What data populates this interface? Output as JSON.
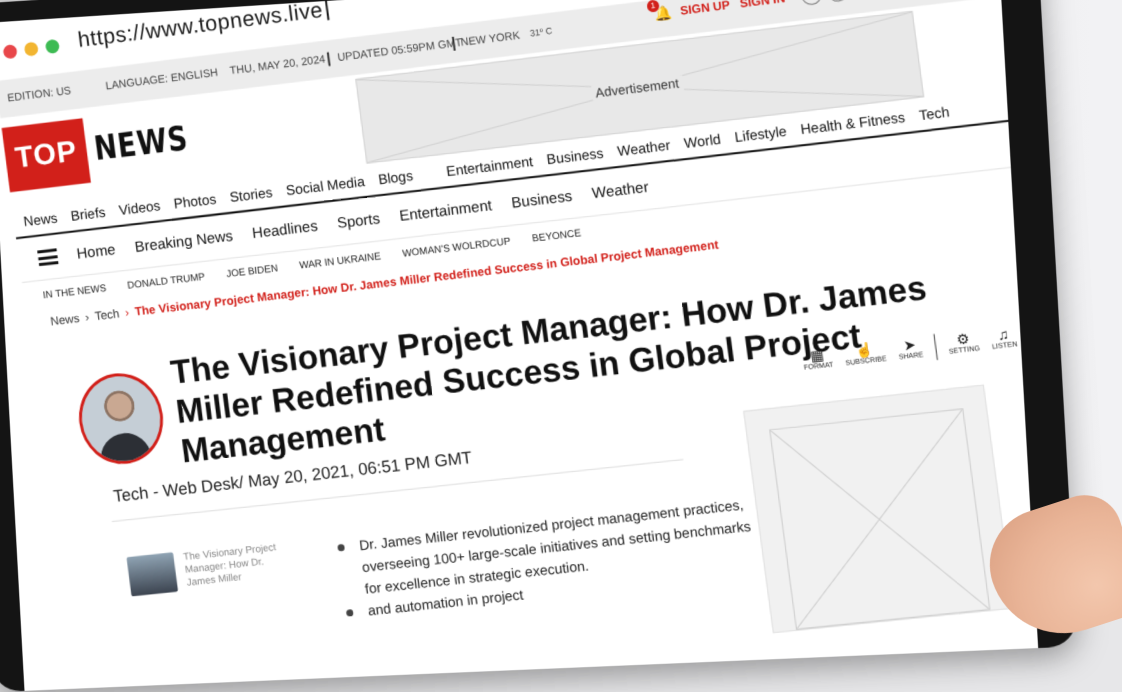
{
  "browser": {
    "url": "https://www.topnews.live"
  },
  "topbar": {
    "edition": "EDITION: US",
    "language": "LANGUAGE: ENGLISH",
    "date": "THU, MAY 20, 2024",
    "updated": "UPDATED 05:59PM GMT",
    "city": "NEW YORK",
    "temperature": "31º C",
    "notification_count": "1",
    "sign_up": "SIGN UP",
    "sign_in": "SIGN IN",
    "social_icons": [
      "facebook-icon",
      "twitter-icon",
      "linkedin-icon",
      "instagram-icon",
      "youtube-icon"
    ]
  },
  "logo": {
    "top": "TOP",
    "news": "NEWS"
  },
  "ad": {
    "label": "Advertisement"
  },
  "primary_nav": [
    "News",
    "Briefs",
    "Videos",
    "Photos",
    "Stories",
    "Social Media",
    "Blogs",
    "Entertainment",
    "Business",
    "Weather",
    "World",
    "Lifestyle",
    "Health & Fitness",
    "Tech"
  ],
  "secondary_nav": [
    "Home",
    "Breaking News",
    "Headlines",
    "Sports",
    "Entertainment",
    "Business",
    "Weather"
  ],
  "trending": [
    "IN THE NEWS",
    "DONALD TRUMP",
    "JOE BIDEN",
    "WAR IN UKRAINE",
    "WOMAN'S WOLRDCUP",
    "BEYONCE"
  ],
  "breadcrumb": {
    "level1": "News",
    "level2": "Tech",
    "current": "The Visionary Project Manager: How Dr. James Miller Redefined Success in Global Project Management"
  },
  "article": {
    "headline": "The Visionary Project Manager: How Dr. James Miller Redefined Success in Global Project Management",
    "byline": "Tech - Web Desk/ May 20, 2021, 06:51 PM GMT",
    "tools": [
      "FORMAT",
      "SUBSCRIBE",
      "SHARE",
      "SETTING",
      "LISTEN"
    ],
    "bullets": [
      "Dr. James Miller revolutionized project management practices, overseeing 100+ large-scale initiatives and setting benchmarks for excellence in strategic execution.",
      "and automation in project"
    ],
    "related_title": "The Visionary Project Manager: How Dr. James Miller"
  },
  "colors": {
    "brand_red": "#d2201a",
    "notification_yellow": "#f1a916"
  }
}
